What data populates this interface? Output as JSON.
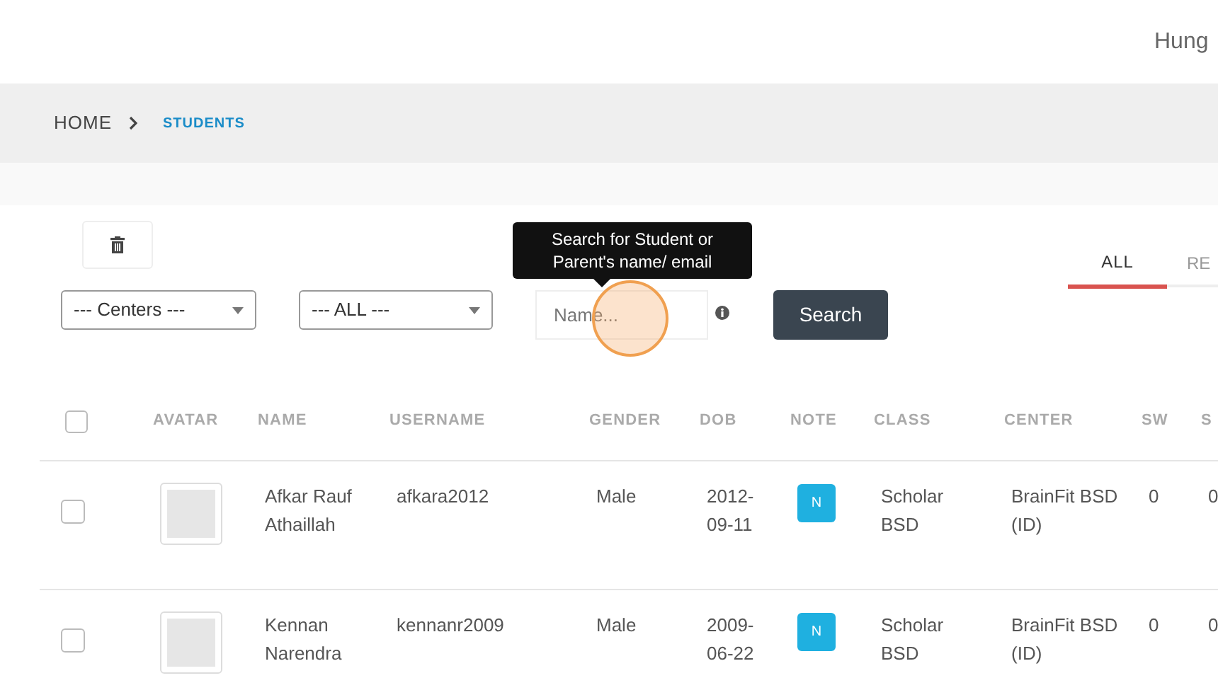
{
  "user": {
    "name": "Hung"
  },
  "breadcrumb": [
    {
      "label": "HOME",
      "selected": false
    },
    {
      "label": "STUDENTS",
      "selected": true
    }
  ],
  "filters": {
    "centers": "--- Centers ---",
    "status": "--- ALL ---",
    "search": {
      "placeholder": "Name..."
    },
    "tooltip": "Search for Student or Parent's name/ email",
    "button": "Search"
  },
  "tabs": [
    {
      "label": "ALL",
      "selected": true
    },
    {
      "label": "RE",
      "selected": false
    }
  ],
  "table": {
    "all_checked": false,
    "columns": [
      "AVATAR",
      "NAME",
      "USERNAME",
      "GENDER",
      "DOB",
      "NOTE",
      "CLASS",
      "CENTER",
      "SW",
      "S"
    ],
    "rows": [
      {
        "checked": false,
        "name": "Afkar Rauf Athaillah",
        "username": "afkara2012",
        "gender": "Male",
        "dob": "2012-09-11",
        "note": "N",
        "class": "Scholar BSD",
        "center": "BrainFit BSD (ID)",
        "sw": "0",
        "column_10": "0"
      },
      {
        "checked": false,
        "name": "Kennan Narendra",
        "username": "kennanr2009",
        "gender": "Male",
        "dob": "2009-06-22",
        "note": "N",
        "class": "Scholar BSD",
        "center": "BrainFit BSD (ID)",
        "sw": "0",
        "column_10": "0"
      }
    ]
  }
}
